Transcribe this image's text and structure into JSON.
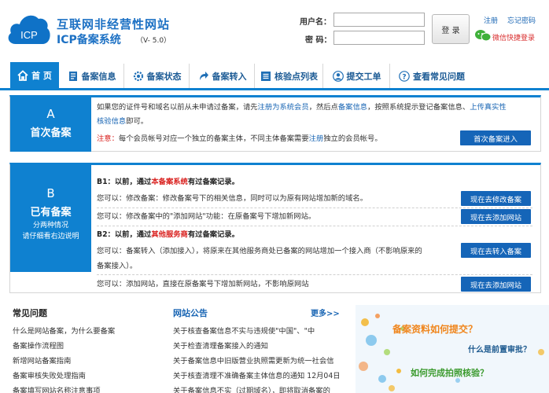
{
  "header": {
    "logo_badge": "ICP",
    "logo_line1": "互联网非经营性网站",
    "logo_line2": "ICP备案系统",
    "version": "（V- 5.0）",
    "username_label": "用户名：",
    "password_label": "密 码：",
    "login_button": "登 录",
    "register_link": "注册",
    "forgot_link": "忘记密码",
    "wechat_login": "微信快捷登录"
  },
  "nav": {
    "items": [
      {
        "label": "首 页",
        "icon": "home-icon",
        "active": true
      },
      {
        "label": "备案信息",
        "icon": "document-icon"
      },
      {
        "label": "备案状态",
        "icon": "gear-icon"
      },
      {
        "label": "备案转入",
        "icon": "arrow-forward-icon"
      },
      {
        "label": "核验点列表",
        "icon": "list-icon"
      },
      {
        "label": "提交工单",
        "icon": "user-icon"
      },
      {
        "label": "查看常见问题",
        "icon": "question-icon"
      }
    ]
  },
  "section_a": {
    "letter": "A",
    "title": "首次备案",
    "line1_pre": "如果您的证件号和域名以前从未申请过备案，请先",
    "line1_link1": "注册为系统会员",
    "line1_mid": "，然后点",
    "line1_link2": "备案信息",
    "line1_post": "，按照系统提示登记备案信息、",
    "line1_link3": "上传真实性",
    "line2_link": "核验信息",
    "line2_post": "即可。",
    "note_label": "注意：",
    "note_text": "每个会员帐号对应一个独立的备案主体，不同主体备案需要",
    "note_link": "注册",
    "note_post": "独立的会员帐号。",
    "button": "首次备案进入"
  },
  "section_b": {
    "letter": "B",
    "title": "已有备案",
    "sub1": "分两种情况",
    "sub2": "请仔细看右边说明",
    "b1_pre": "B1：以前，通过",
    "b1_red": "本备案系统",
    "b1_post": "有过备案记录。",
    "b1_row1": "您可以：修改备案：修改备案号下的相关信息，同时可以为原有网站增加新的域名。",
    "b1_row1_button": "现在去修改备案",
    "b1_row2": "您可以：修改备案中的\"添加网站\"功能：在原备案号下增加新网站。",
    "b1_row2_button": "现在去添加网站",
    "b2_pre": "B2：以前，通过",
    "b2_red": "其他服务商",
    "b2_post": "有过备案记录。",
    "b2_row1_a": "您可以：备案转入（添加接入），将原来在其他服务商处已备案的网站增加一个接入商（不影响原来的",
    "b2_row1_b": "备案接入）。",
    "b2_row1_button": "现在去转入备案",
    "b2_row2": "您可以：添加网站，直接在原备案号下增加新网站，不影响原网站",
    "b2_row2_button": "现在去添加网站"
  },
  "faq": {
    "title": "常见问题",
    "items": [
      "什么是网站备案，为什么要备案",
      "备案操作流程图",
      "新增网站备案指南",
      "备案审核失败处理指南",
      "备案填写网站名称注意事项"
    ]
  },
  "announcements": {
    "title": "网站公告",
    "more": "更多>>",
    "items": [
      "关于核查备案信息不实与违规使\"中国\"、\"中",
      "关于检查清理备案接入的通知",
      "关于备案信息中旧版营业执照需更新为统一社会信",
      "关于核查清理不准确备案主体信息的通知 12月04日",
      "关于备案信息不实（过期域名），即将取消备案的"
    ]
  },
  "promo": {
    "q1": "备案资料如何提交？",
    "q2": "什么是前置审批？",
    "q3": "如何完成拍照核验？"
  },
  "colors": {
    "brand_blue": "#0f81d0",
    "button_blue": "#1565b8",
    "link_blue": "#1a66b4",
    "alert_red": "#d9201e",
    "promo_orange": "#f0851b"
  }
}
